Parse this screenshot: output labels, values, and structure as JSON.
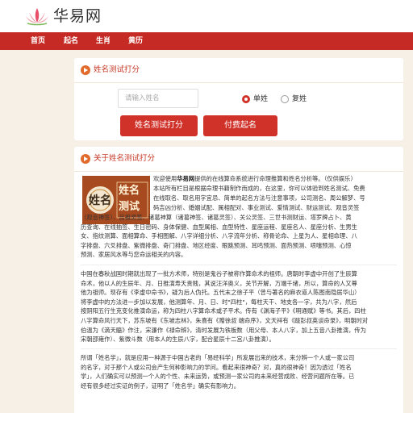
{
  "site": {
    "name": "华易网"
  },
  "nav": {
    "items": [
      "首页",
      "起名",
      "生肖",
      "黄历"
    ]
  },
  "name_test": {
    "title": "姓名测试打分",
    "input_placeholder": "请输入姓名",
    "options": [
      "单姓",
      "复姓"
    ],
    "selected_option": "单姓",
    "buttons": {
      "test": "姓名测试打分",
      "paid": "付费起名"
    }
  },
  "about": {
    "title": "关于姓名测试打分",
    "image_text": [
      "姓名",
      "测试"
    ],
    "intro_lines": [
      [
        "欢迎使用",
        "华易网",
        "提供的在线算命系统进行命理推算和姓名分析等。（仅供娱乐）"
      ],
      [
        "本站所有栏目是根据命理书籍制作而成的，在这里，你可以体验到姓名测试、免费"
      ],
      [
        "在线取名、取名用字宜忌、简单的起名方法与注意事项，公司测名、周公解梦、号"
      ],
      [
        "码吉凶分析、婚姻试配、属相配对、事业测试、爱情测试、财运测试、观音灵签"
      ]
    ],
    "intro_full_lines": [
      "（观音神签）、吕祖灵签、诸葛神算（诸葛神签、诸葛灵签）、关公灵签、三世书测财运、塔罗牌占卜、黄",
      "历查询、在线抽签、生日密码、身体保健、血型属相、血型特性、星座运程、星座名人、星座分析、生男生",
      "女、指纹测算、面相算命、手相图解、八字详细分析、八字流年分析、称骨论命、上星为人、星相命理、八",
      "字排盘、六爻排盘、紫微排盘、奇门排盘、地区经度、眼跳预测、耳鸣预测、面热预测、喷嚏预测、心惊",
      "预测、家居风水等与您命运相关的内容。"
    ],
    "history_lines": [
      "中国在春秋战国时期就出现了一批方术师，特别是鬼谷子被称作算命术的祖师。唐朝时李虚中开创了生辰算",
      "命术，他以人的生辰年、月、日推演寿夭贵贱，其说汪洋奥义，关节开解，万端千绪，所以，算命的人又尊",
      "他为祖师。现存有《李虚中命书》，疑为后人伪托。五代末之徐子平（曾与著名的麻衣道人陈图南隐居华山）",
      "将李虚中的方法进一步加以发展，他测算年、月、日、时\"四柱\"，每柱天干、地支各一字，共为八字，然后",
      "按阴阳五行生克变化推演命运，称为四柱八字算命术或子平术。传有《渊海子平》《明通赋》等书。其后，四柱",
      "八字算命风行天下，苏东坡有《东坡志林》，朱熹有《赠徐叔 端命序》，文天祥有《跋彭叔英谈命录》，明朝时对",
      "伯温为《滴天髓》作注，宋濂作《禄命辨》，清时发展为铁板数（用父母、本人八字，加上五音八卦推演，传为",
      "宋朝邵雍作）、紫微斗数（用本人的生辰八字，配合星辰十二宫八卦推演）。"
    ],
    "meaning_lines": [
      "所谓「姓名学」，就是应用一种源于中国古老的「易经科学」所发展出来的技术，来分辨一个人或一家公司",
      "的名字，对于那个人或公司会产生何种影响力的学问。看起来很神奇？对，真的很神奇！因为透过「姓名",
      "学」，人们确实可以预测一个人的个性、未来运势，或预测一家公司的未来经营成败、经营问题所在等。已",
      "经有很多经过实证的例子，证明了「姓名学」确实有影响力。"
    ]
  }
}
